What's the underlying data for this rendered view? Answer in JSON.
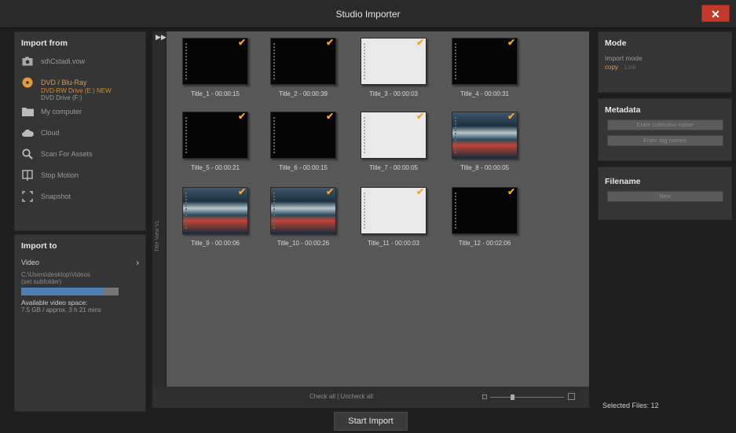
{
  "window": {
    "title": "Studio Importer",
    "close": "✕"
  },
  "import_from": {
    "heading": "Import from",
    "items": [
      {
        "icon": "camera-icon",
        "label": "sd\\Cstadi.vow"
      },
      {
        "icon": "disc-icon",
        "label": "DVD / Blu-Ray",
        "active": true
      },
      {
        "icon": "folder-icon",
        "label": "My computer"
      },
      {
        "icon": "cloud-icon",
        "label": "Cloud"
      },
      {
        "icon": "search-icon",
        "label": "Scan For Assets"
      },
      {
        "icon": "stop-motion-icon",
        "label": "Stop Motion"
      },
      {
        "icon": "snapshot-icon",
        "label": "Snapshot"
      }
    ],
    "dvd_sub_line1": "DVD-RW Drive (E:) NEW",
    "dvd_sub_line2": "DVD Drive (F:)"
  },
  "import_to": {
    "heading": "Import to",
    "video_label": "Video",
    "path_line1": "C:\\Users\\desktop\\Videos",
    "path_line2": "(set subfolder)",
    "space_fraction": 0.85,
    "available_label": "Available video space:",
    "available_value": "7.5 GB / approx. 3 h 21 mins"
  },
  "strip": {
    "collapse_arrow": "▶▶",
    "vertical_text": "Title View VL"
  },
  "titles": [
    {
      "caption": "Title_1 - 00:00:15",
      "style": "black"
    },
    {
      "caption": "Title_2 - 00:00:39",
      "style": "black"
    },
    {
      "caption": "Title_3 - 00:00:03",
      "style": "white"
    },
    {
      "caption": "Title_4 - 00:00:31",
      "style": "black"
    },
    {
      "caption": "Title_5 - 00:00:21",
      "style": "black"
    },
    {
      "caption": "Title_6 - 00:00:15",
      "style": "black"
    },
    {
      "caption": "Title_7 - 00:00:05",
      "style": "white"
    },
    {
      "caption": "Title_8 - 00:00:05",
      "style": "pic"
    },
    {
      "caption": "Title_9 - 00:00:06",
      "style": "pic"
    },
    {
      "caption": "Title_10 - 00:00:26",
      "style": "pic"
    },
    {
      "caption": "Title_11 - 00:00:03",
      "style": "white"
    },
    {
      "caption": "Title_12 - 00:02:06",
      "style": "black"
    }
  ],
  "bottombar": {
    "check_all": "Check all | Uncheck all"
  },
  "mode": {
    "heading": "Mode",
    "label": "Import mode",
    "active": "copy",
    "inactive": "Link"
  },
  "metadata": {
    "heading": "Metadata",
    "btn1": "Enter collection name",
    "btn2": "Enter tag names"
  },
  "filename": {
    "heading": "Filename",
    "btn": "New"
  },
  "status": {
    "selected_files": "Selected Files: 12"
  },
  "actions": {
    "start_import": "Start Import"
  },
  "colors": {
    "accent": "#e39a3a",
    "progress": "#4f7fb6",
    "close": "#c0392b"
  }
}
